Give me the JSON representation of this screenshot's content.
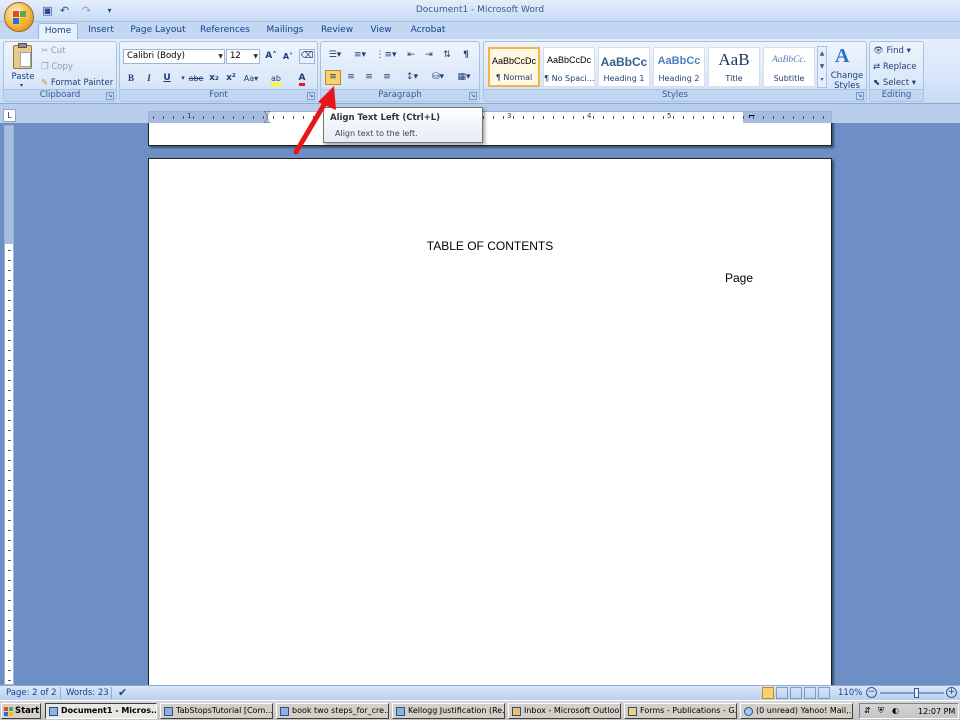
{
  "window": {
    "title": "Document1 - Microsoft Word"
  },
  "tabs": [
    "Home",
    "Insert",
    "Page Layout",
    "References",
    "Mailings",
    "Review",
    "View",
    "Acrobat"
  ],
  "clipboard": {
    "paste": "Paste",
    "cut": "Cut",
    "copy": "Copy",
    "format_painter": "Format Painter",
    "label": "Clipboard"
  },
  "font": {
    "name": "Calibri (Body)",
    "size": "12",
    "label": "Font"
  },
  "paragraph": {
    "label": "Paragraph"
  },
  "styles": {
    "label": "Styles",
    "items": [
      {
        "sample": "AaBbCcDc",
        "name": "¶ Normal"
      },
      {
        "sample": "AaBbCcDc",
        "name": "¶ No Spaci..."
      },
      {
        "sample": "AaBbCc",
        "name": "Heading 1"
      },
      {
        "sample": "AaBbCc",
        "name": "Heading 2"
      },
      {
        "sample": "AaB",
        "name": "Title"
      },
      {
        "sample": "AaBbCc.",
        "name": "Subtitle"
      }
    ],
    "change_styles": "Change Styles"
  },
  "editing": {
    "find": "Find",
    "replace": "Replace",
    "select": "Select",
    "label": "Editing"
  },
  "tooltip": {
    "title": "Align Text Left (Ctrl+L)",
    "body": "Align text to the left."
  },
  "ruler": {
    "numbers": [
      "1",
      "1",
      "2",
      "3",
      "4",
      "5"
    ]
  },
  "document": {
    "heading": "TABLE OF CONTENTS",
    "page_label": "Page"
  },
  "status": {
    "page": "Page: 2 of 2",
    "words": "Words: 23",
    "zoom": "110%"
  },
  "taskbar": {
    "start": "Start",
    "tasks": [
      "Document1 - Micros...",
      "TabStopsTutorial [Com...",
      "book two steps_for_cre...",
      "Kellogg Justification (Re...",
      "Inbox - Microsoft Outlook",
      "Forms - Publications - G...",
      "(0 unread) Yahoo! Mail,..."
    ],
    "clock": "12:07 PM"
  },
  "colors": {
    "accent_arrow": "#e8161b",
    "ribbon_bg": "#d7e6f9",
    "workspace": "#6d8fc6",
    "selected_style": "#f2b54b"
  }
}
